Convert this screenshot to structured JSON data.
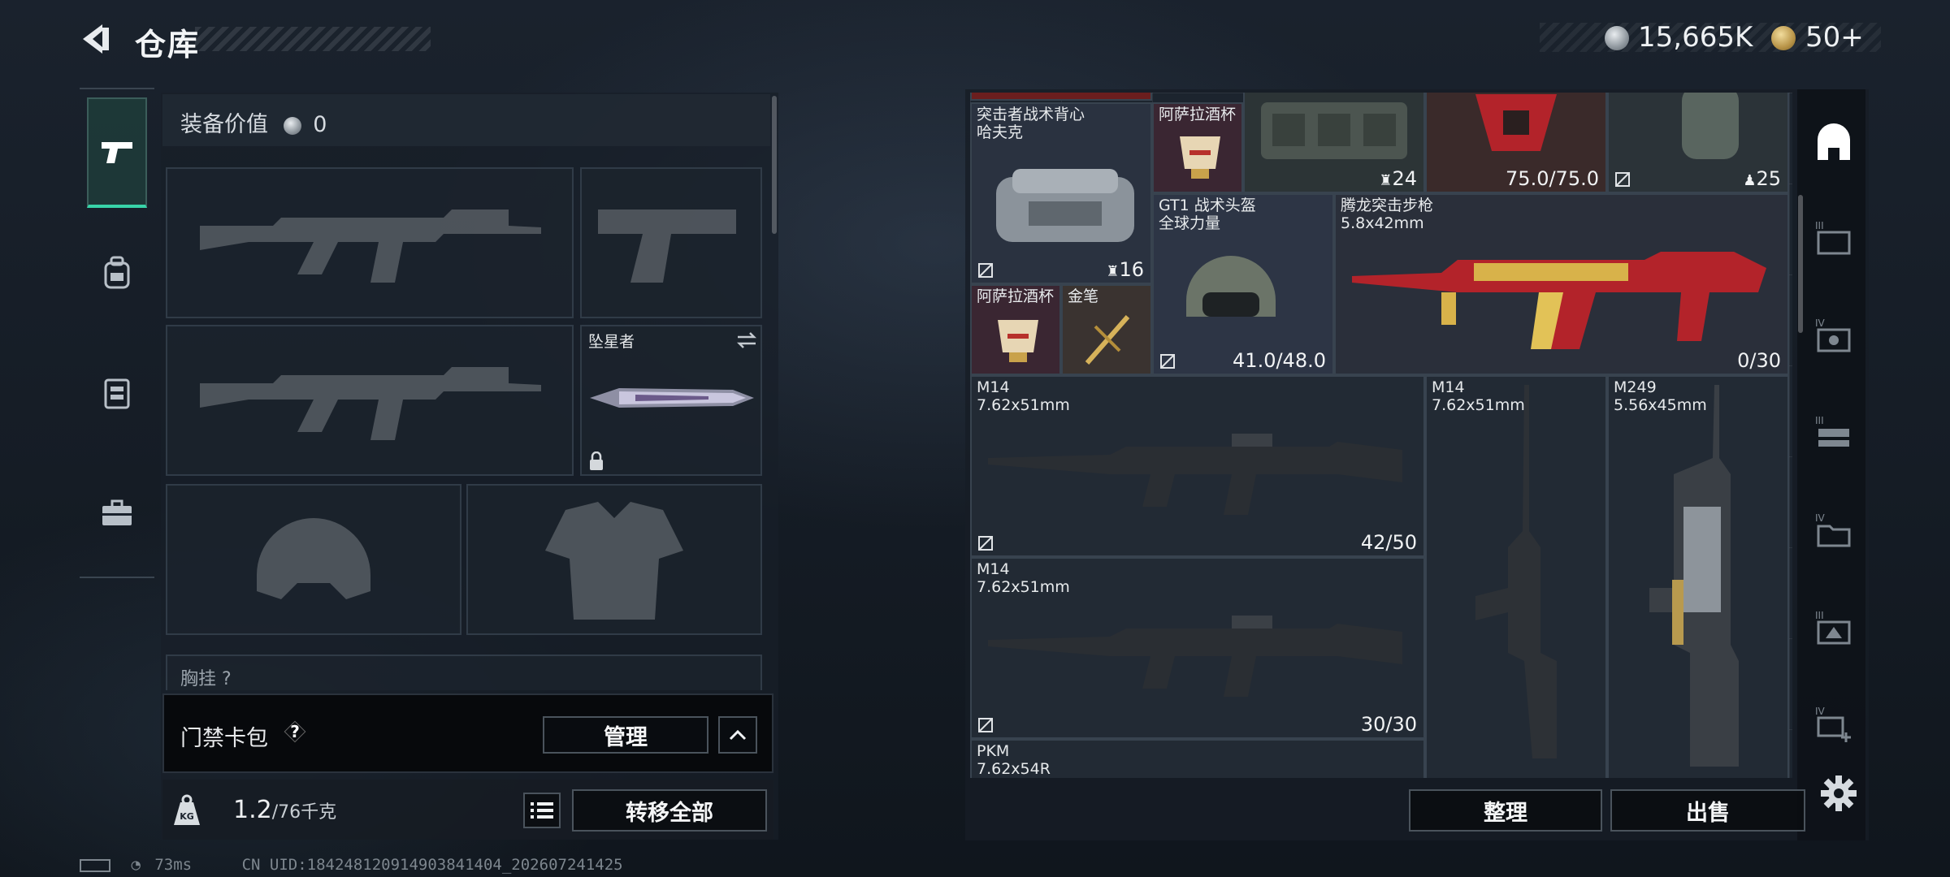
{
  "header": {
    "title": "仓库",
    "currency": [
      {
        "icon": "silver-coin-icon",
        "value": "15,665K"
      },
      {
        "icon": "gold-coin-icon",
        "value": "50+"
      }
    ]
  },
  "tabs": [
    {
      "name": "weapons",
      "icon": "pistol-icon",
      "active": true
    },
    {
      "name": "backpack",
      "icon": "backpack-icon",
      "active": false
    },
    {
      "name": "vest",
      "icon": "vest-icon",
      "active": false
    },
    {
      "name": "toolkit",
      "icon": "briefcase-icon",
      "active": false
    }
  ],
  "loadout": {
    "value_label": "装备价值",
    "value": "0",
    "melee_name": "坠星者",
    "chest_label": "胸挂",
    "chest_hint": "?",
    "keycard_label": "门禁卡包",
    "help": "?",
    "manage_label": "管理",
    "weight_current": "1.2",
    "weight_max": "/76千克",
    "transfer_all_label": "转移全部"
  },
  "stash": {
    "items": [
      {
        "name": "突击者战术背心",
        "sub": "哈夫克",
        "count": "16"
      },
      {
        "name": "阿萨拉酒杯",
        "sub": ""
      },
      {
        "name": "",
        "count": "24"
      },
      {
        "name": "",
        "durability": "75.0/75.0"
      },
      {
        "name": "",
        "count": "25"
      },
      {
        "name": "GT1 战术头盔",
        "sub": "全球力量",
        "durability": "41.0/48.0"
      },
      {
        "name": "腾龙突击步枪",
        "sub": "5.8x42mm",
        "ammo": "0/30"
      },
      {
        "name": "阿萨拉酒杯",
        "sub": ""
      },
      {
        "name": "金笔",
        "sub": ""
      },
      {
        "name": "M14",
        "sub": "7.62x51mm",
        "ammo": "42/50"
      },
      {
        "name": "M14",
        "sub": "7.62x51mm",
        "ammo": ""
      },
      {
        "name": "M249",
        "sub": "5.56x45mm",
        "ammo": ""
      },
      {
        "name": "M14",
        "sub": "7.62x51mm",
        "ammo": "30/30"
      },
      {
        "name": "PKM",
        "sub": "7.62x54R"
      }
    ],
    "sort_label": "整理",
    "sell_label": "出售"
  },
  "right_rail": [
    "base-icon",
    "tier3-container-icon",
    "tier4-case-icon",
    "tier3-rack-icon",
    "tier4-folder-icon",
    "tier3-box-icon",
    "tier4-add-icon"
  ],
  "status": {
    "ping": "73ms",
    "uid": "CN UID:18424812091490384140­4_202607241425"
  },
  "colors": {
    "accent": "#38d3a8",
    "gold": "#c9a24b"
  }
}
